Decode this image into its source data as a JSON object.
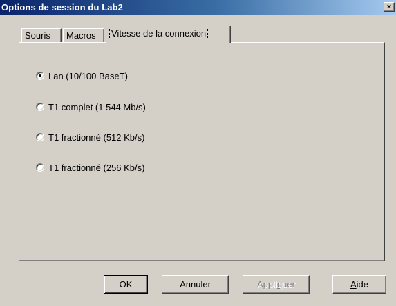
{
  "window": {
    "title": "Options de session du Lab2",
    "close_glyph": "×"
  },
  "tabs": [
    {
      "label": "Souris",
      "active": false
    },
    {
      "label": "Macros",
      "active": false
    },
    {
      "label": "Vitesse de la connexion",
      "active": true
    }
  ],
  "connection_speed": {
    "options": [
      {
        "label": "Lan (10/100 BaseT)",
        "selected": true
      },
      {
        "label": "T1 complet (1 544 Mb/s)",
        "selected": false
      },
      {
        "label": "T1 fractionné (512 Kb/s)",
        "selected": false
      },
      {
        "label": "T1 fractionné (256 Kb/s)",
        "selected": false
      }
    ]
  },
  "buttons": {
    "ok": {
      "label": "OK"
    },
    "cancel": {
      "label": "Annuler"
    },
    "apply": {
      "label_prefix": "Appli",
      "label_mnemonic": "q",
      "label_suffix": "uer",
      "enabled": false
    },
    "help": {
      "label_mnemonic": "A",
      "label_suffix": "ide"
    }
  }
}
